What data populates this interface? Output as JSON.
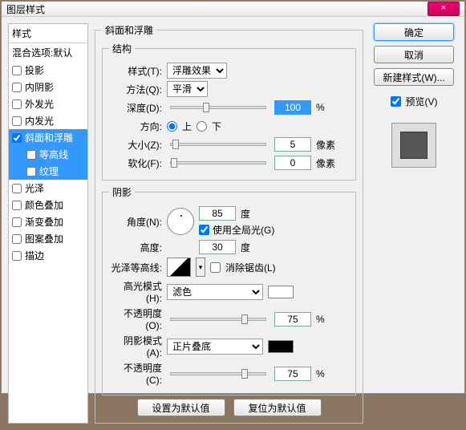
{
  "window": {
    "title": "图层样式",
    "close_glyph": "×"
  },
  "sidebar": {
    "styles_header": "样式",
    "blend_header": "混合选项:默认",
    "items": [
      {
        "label": "投影",
        "checked": false,
        "sub": false,
        "selected": false
      },
      {
        "label": "内阴影",
        "checked": false,
        "sub": false,
        "selected": false
      },
      {
        "label": "外发光",
        "checked": false,
        "sub": false,
        "selected": false
      },
      {
        "label": "内发光",
        "checked": false,
        "sub": false,
        "selected": false
      },
      {
        "label": "斜面和浮雕",
        "checked": true,
        "sub": false,
        "selected": true
      },
      {
        "label": "等高线",
        "checked": false,
        "sub": true,
        "selected": true
      },
      {
        "label": "纹理",
        "checked": false,
        "sub": true,
        "selected": true
      },
      {
        "label": "光泽",
        "checked": false,
        "sub": false,
        "selected": false
      },
      {
        "label": "颜色叠加",
        "checked": false,
        "sub": false,
        "selected": false
      },
      {
        "label": "渐变叠加",
        "checked": false,
        "sub": false,
        "selected": false
      },
      {
        "label": "图案叠加",
        "checked": false,
        "sub": false,
        "selected": false
      },
      {
        "label": "描边",
        "checked": false,
        "sub": false,
        "selected": false
      }
    ]
  },
  "panel": {
    "title": "斜面和浮雕",
    "structure": {
      "legend": "结构",
      "style_label": "样式(T):",
      "style_value": "浮雕效果",
      "technique_label": "方法(Q):",
      "technique_value": "平滑",
      "depth_label": "深度(D):",
      "depth_value": "100",
      "depth_unit": "%",
      "direction_label": "方向:",
      "up_label": "上",
      "down_label": "下",
      "size_label": "大小(Z):",
      "size_value": "5",
      "size_unit": "像素",
      "soften_label": "软化(F):",
      "soften_value": "0",
      "soften_unit": "像素"
    },
    "shading": {
      "legend": "阴影",
      "angle_label": "角度(N):",
      "angle_value": "85",
      "angle_unit": "度",
      "global_light_label": "使用全局光(G)",
      "altitude_label": "高度:",
      "altitude_value": "30",
      "altitude_unit": "度",
      "gloss_label": "光泽等高线:",
      "antialias_label": "消除锯齿(L)",
      "highlight_mode_label": "高光模式(H):",
      "highlight_mode_value": "滤色",
      "highlight_color": "#ffffff",
      "highlight_op_label": "不透明度(O):",
      "highlight_op_value": "75",
      "op_unit": "%",
      "shadow_mode_label": "阴影模式(A):",
      "shadow_mode_value": "正片叠底",
      "shadow_color": "#000000",
      "shadow_op_label": "不透明度(C):",
      "shadow_op_value": "75"
    },
    "buttons": {
      "make_default": "设置为默认值",
      "reset_default": "复位为默认值"
    }
  },
  "right": {
    "ok": "确定",
    "cancel": "取消",
    "new_style": "新建样式(W)...",
    "preview_label": "预览(V)"
  }
}
